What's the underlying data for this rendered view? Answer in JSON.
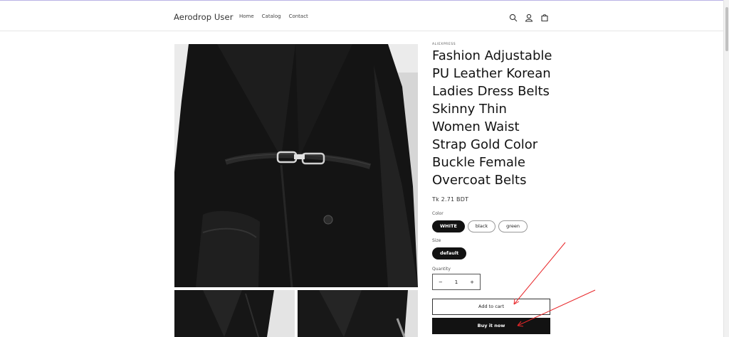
{
  "header": {
    "brand": "Aerodrop User",
    "nav": [
      "Home",
      "Catalog",
      "Contact"
    ],
    "icons": [
      "search-icon",
      "account-icon",
      "cart-icon"
    ]
  },
  "product": {
    "vendor": "ALIEXPRESS",
    "title": "Fashion Adjustable PU Leather Korean Ladies Dress Belts Skinny Thin Women Waist Strap Gold Color Buckle Female Overcoat Belts",
    "price": "Tk 2.71 BDT",
    "color_label": "Color",
    "colors": [
      "WHITE",
      "black",
      "green"
    ],
    "size_label": "Size",
    "sizes": [
      "default"
    ],
    "quantity_label": "Quantity",
    "quantity": "1",
    "minus": "−",
    "plus": "+",
    "add_to_cart": "Add to cart",
    "buy_now": "Buy it now"
  },
  "annotation_color": "#e8272a"
}
